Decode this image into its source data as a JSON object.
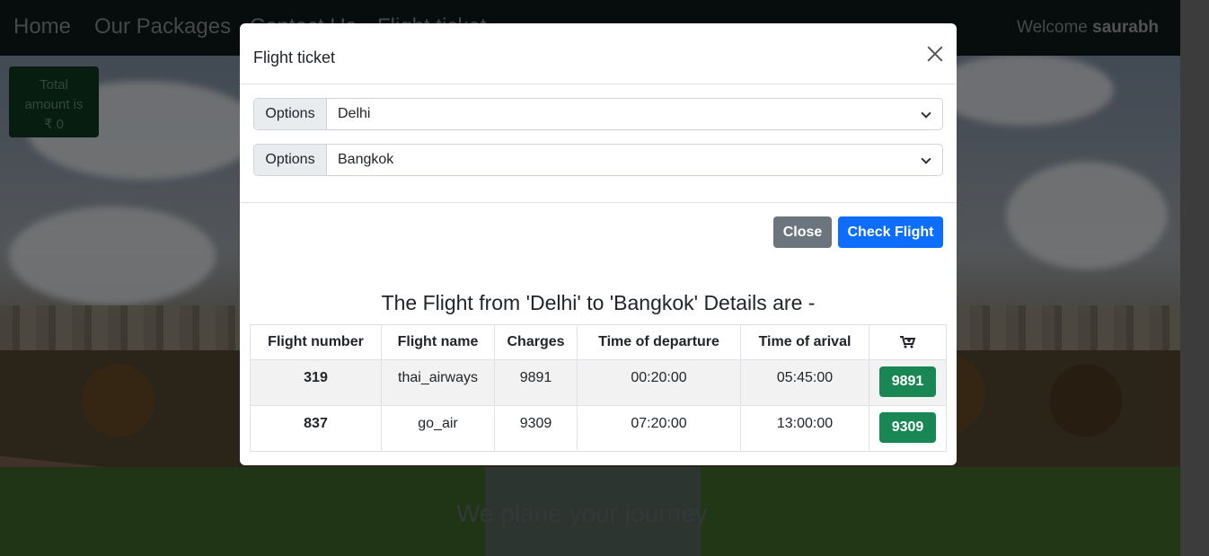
{
  "navbar": {
    "links": [
      "Home",
      "Our Packages",
      "Contact Us",
      "Flight ticket"
    ],
    "welcome_prefix": "Welcome",
    "username": "saurabh"
  },
  "total": {
    "line1": "Total",
    "line2": "amount is",
    "line3": "₹ 0"
  },
  "tagline": "We plane your journey",
  "modal": {
    "title": "Flight ticket",
    "from": {
      "label": "Options",
      "value": "Delhi"
    },
    "to": {
      "label": "Options",
      "value": "Bangkok"
    },
    "close_label": "Close",
    "check_label": "Check Flight",
    "results_title": "The Flight from 'Delhi' to 'Bangkok' Details are -",
    "table": {
      "headers": [
        "Flight number",
        "Flight name",
        "Charges",
        "Time of departure",
        "Time of arival"
      ],
      "cart_icon": "cart-plus-icon",
      "rows": [
        {
          "number": "319",
          "name": "thai_airways",
          "charges": "9891",
          "departure": "00:20:00",
          "arrival": "05:45:00",
          "price": "9891"
        },
        {
          "number": "837",
          "name": "go_air",
          "charges": "9309",
          "departure": "07:20:00",
          "arrival": "13:00:00",
          "price": "9309"
        }
      ]
    }
  },
  "colors": {
    "primary": "#0d6efd",
    "secondary": "#6c757d",
    "success": "#198754",
    "navbar": "#0f1818"
  }
}
